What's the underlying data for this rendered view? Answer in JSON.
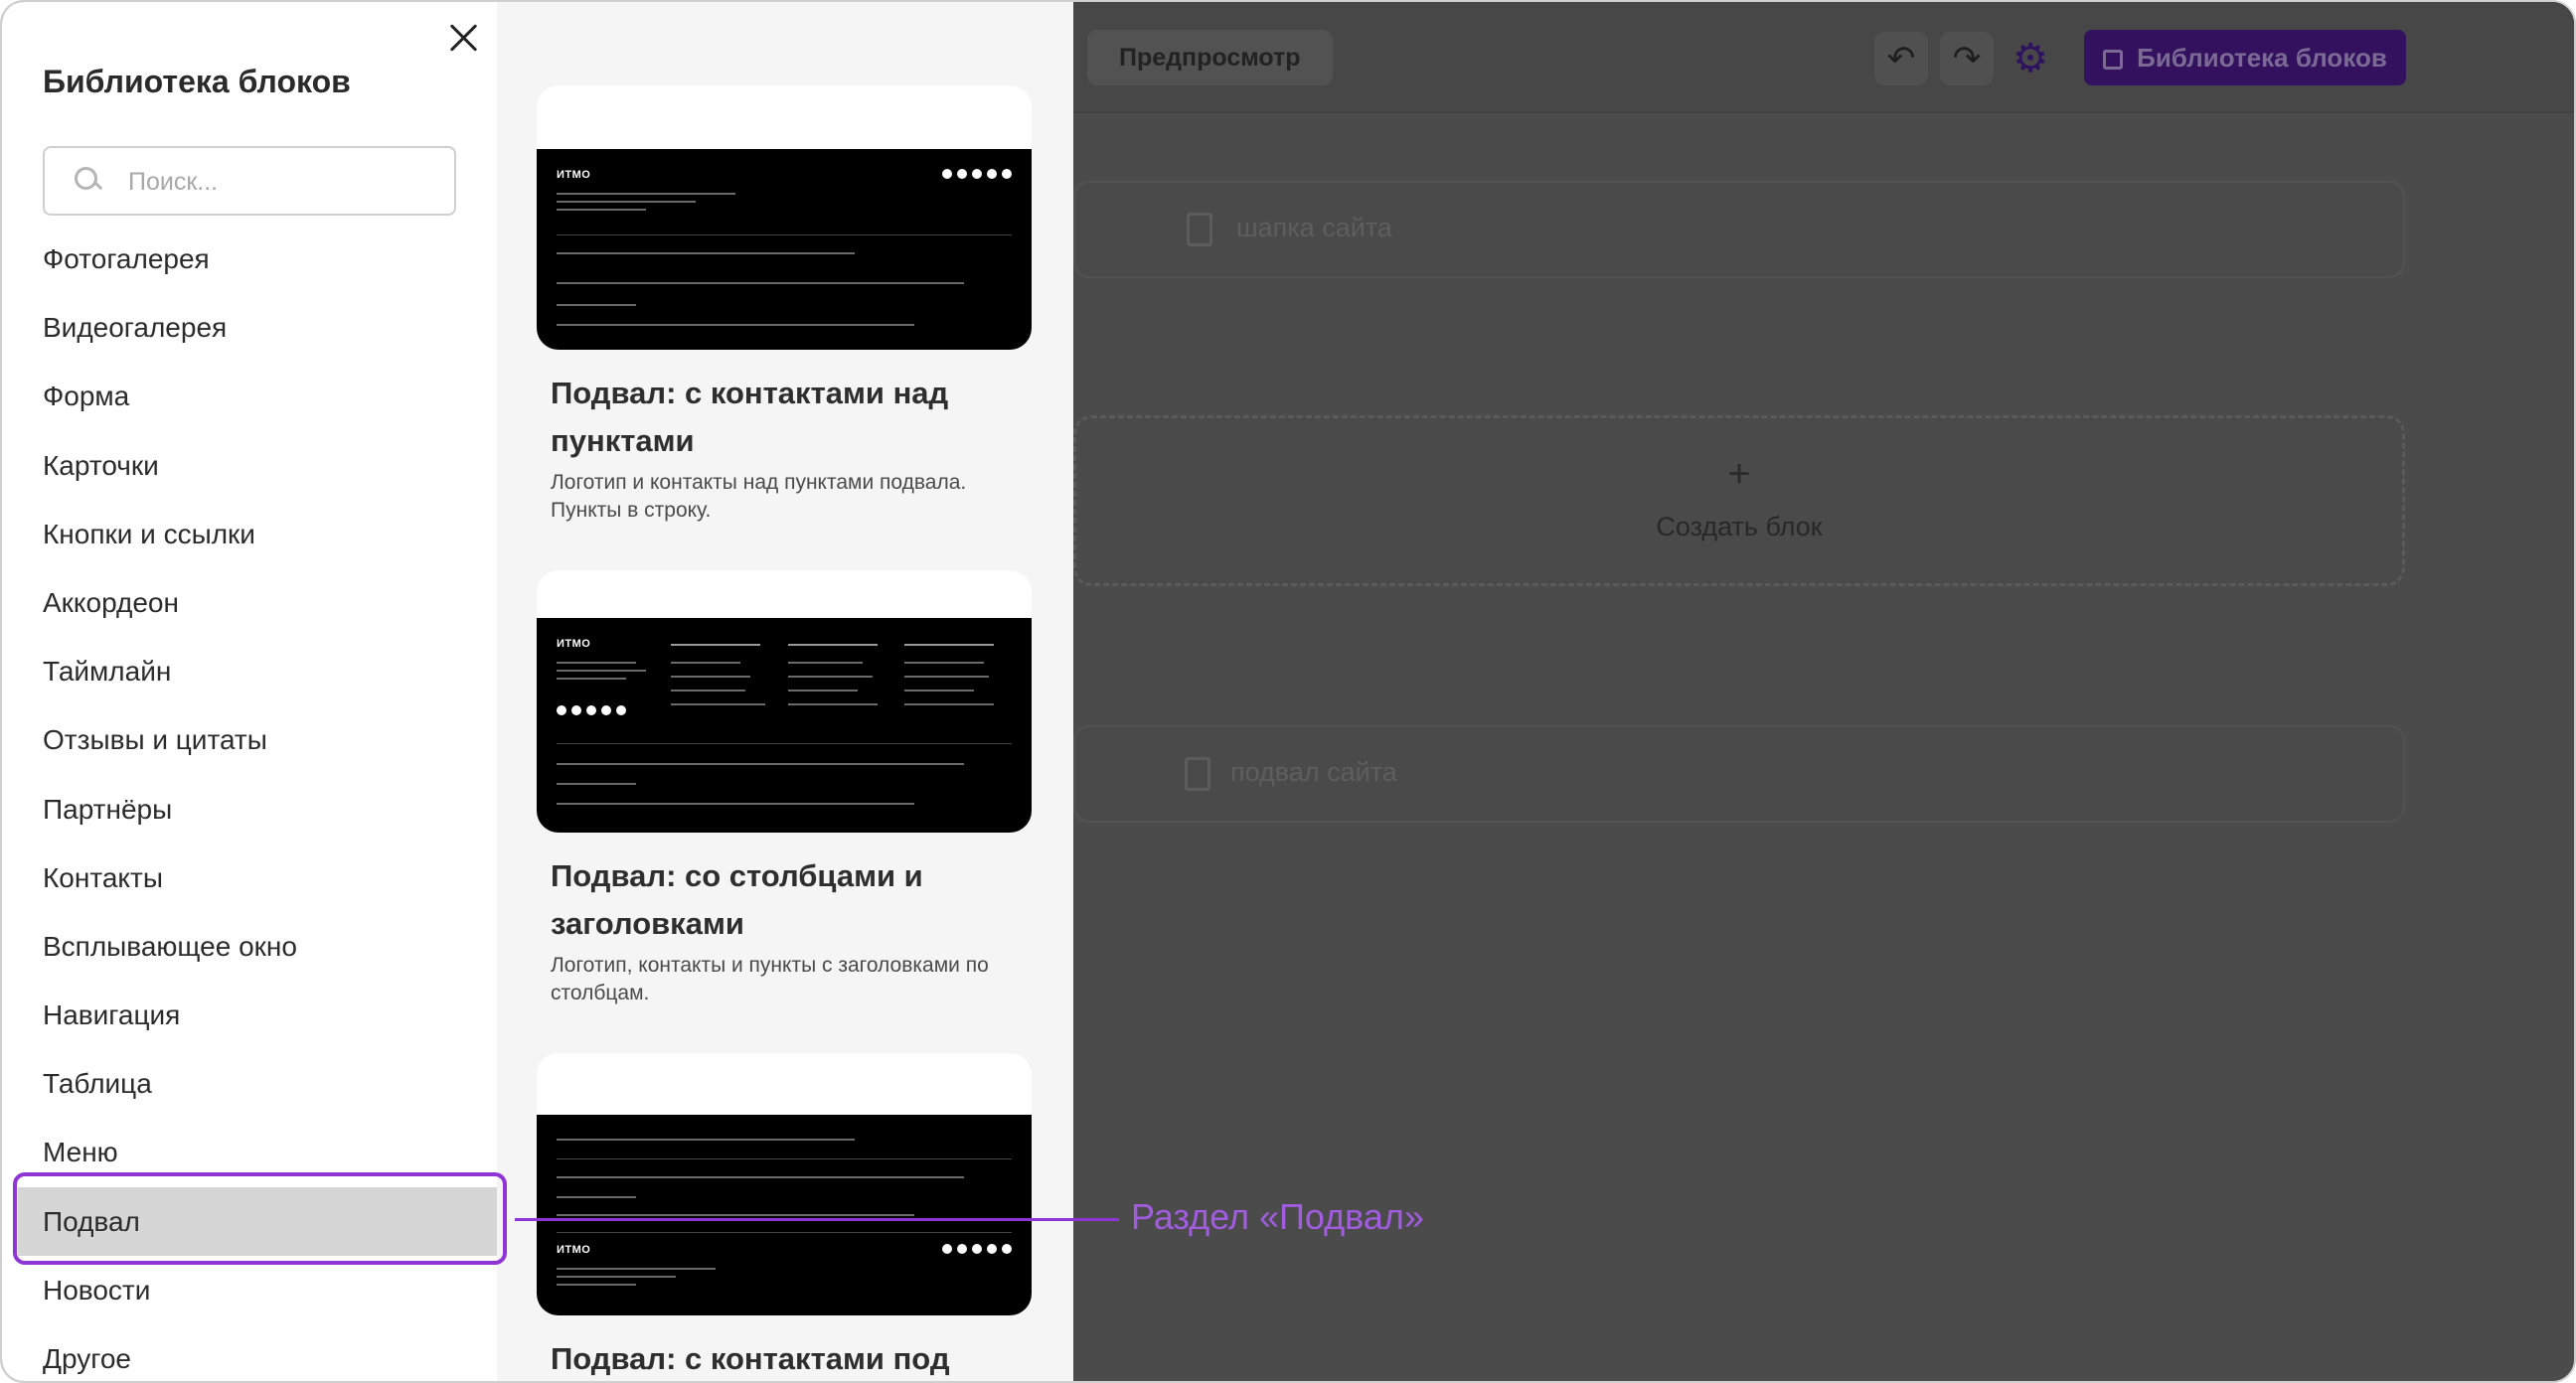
{
  "sidebar": {
    "title": "Библиотека блоков",
    "search_placeholder": "Поиск...",
    "items": [
      "Фотогалерея",
      "Видеогалерея",
      "Форма",
      "Карточки",
      "Кнопки и ссылки",
      "Аккордеон",
      "Таймлайн",
      "Отзывы и цитаты",
      "Партнёры",
      "Контакты",
      "Всплывающее окно",
      "Навигация",
      "Таблица",
      "Меню",
      "Подвал",
      "Новости",
      "Другое"
    ],
    "active_item": "Подвал"
  },
  "cards": [
    {
      "title": "Подвал: с контактами над пунктами",
      "description": "Логотип и контакты над пунктами подвала. Пункты в строку.",
      "thumb_logo": "ИТМО"
    },
    {
      "title": "Подвал: со столбцами и заголовками",
      "description": "Логотип, контакты и пункты с заголовками по столбцам.",
      "thumb_logo": "ИТМО"
    },
    {
      "title": "Подвал: с контактами под",
      "description": "",
      "thumb_logo": "ИТМО"
    }
  ],
  "editor": {
    "preview_label": "Предпросмотр",
    "library_button_label": "Библиотека блоков",
    "header_block_label": "шапка сайта",
    "create_block_label": "Создать блок",
    "footer_block_label": "подвал сайта"
  },
  "callout": {
    "text": "Раздел «Подвал»",
    "color": "#8f35d6"
  },
  "colors": {
    "accent": "#8f35d6",
    "library_button_bg": "#33115f",
    "active_item_bg": "#d6d6d6"
  },
  "icons": [
    "close-icon",
    "search-icon",
    "undo-icon",
    "redo-icon",
    "gear-icon",
    "image-icon",
    "plus-icon"
  ]
}
